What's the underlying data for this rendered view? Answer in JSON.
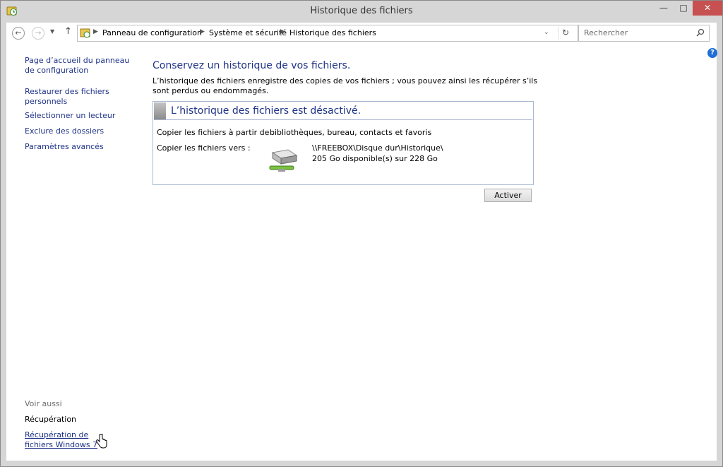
{
  "window": {
    "title": "Historique des fichiers"
  },
  "breadcrumb": [
    "Panneau de configuration",
    "Système et sécurité",
    "Historique des fichiers"
  ],
  "search": {
    "placeholder": "Rechercher"
  },
  "sidebar": {
    "links": [
      "Page d’accueil du panneau de configuration",
      "Restaurer des fichiers personnels",
      "Sélectionner un lecteur",
      "Exclure des dossiers",
      "Paramètres avancés"
    ],
    "see_also_heading": "Voir aussi",
    "see_also": [
      "Récupération",
      "Récupération de fichiers Windows 7"
    ]
  },
  "main": {
    "title": "Conservez un historique de vos fichiers.",
    "description": "L’historique des fichiers enregistre des copies de vos fichiers ; vous pouvez ainsi les récupérer s’ils sont perdus ou endommagés.",
    "status_title": "L’historique des fichiers est désactivé.",
    "copy_from_label": "Copier les fichiers à partir de :",
    "copy_from_value": "bibliothèques, bureau, contacts et favoris",
    "copy_to_label": "Copier les fichiers vers :",
    "drive_path": "\\\\FREEBOX\\Disque dur\\Historique\\",
    "drive_space": "205 Go disponible(s) sur 228 Go",
    "activate_label": "Activer"
  },
  "icons": [
    "file-history-app-icon",
    "back-arrow-icon",
    "forward-arrow-icon",
    "dropdown-chevron-icon",
    "up-arrow-icon",
    "refresh-icon",
    "search-icon",
    "help-icon",
    "network-drive-icon",
    "hand-cursor-icon"
  ]
}
